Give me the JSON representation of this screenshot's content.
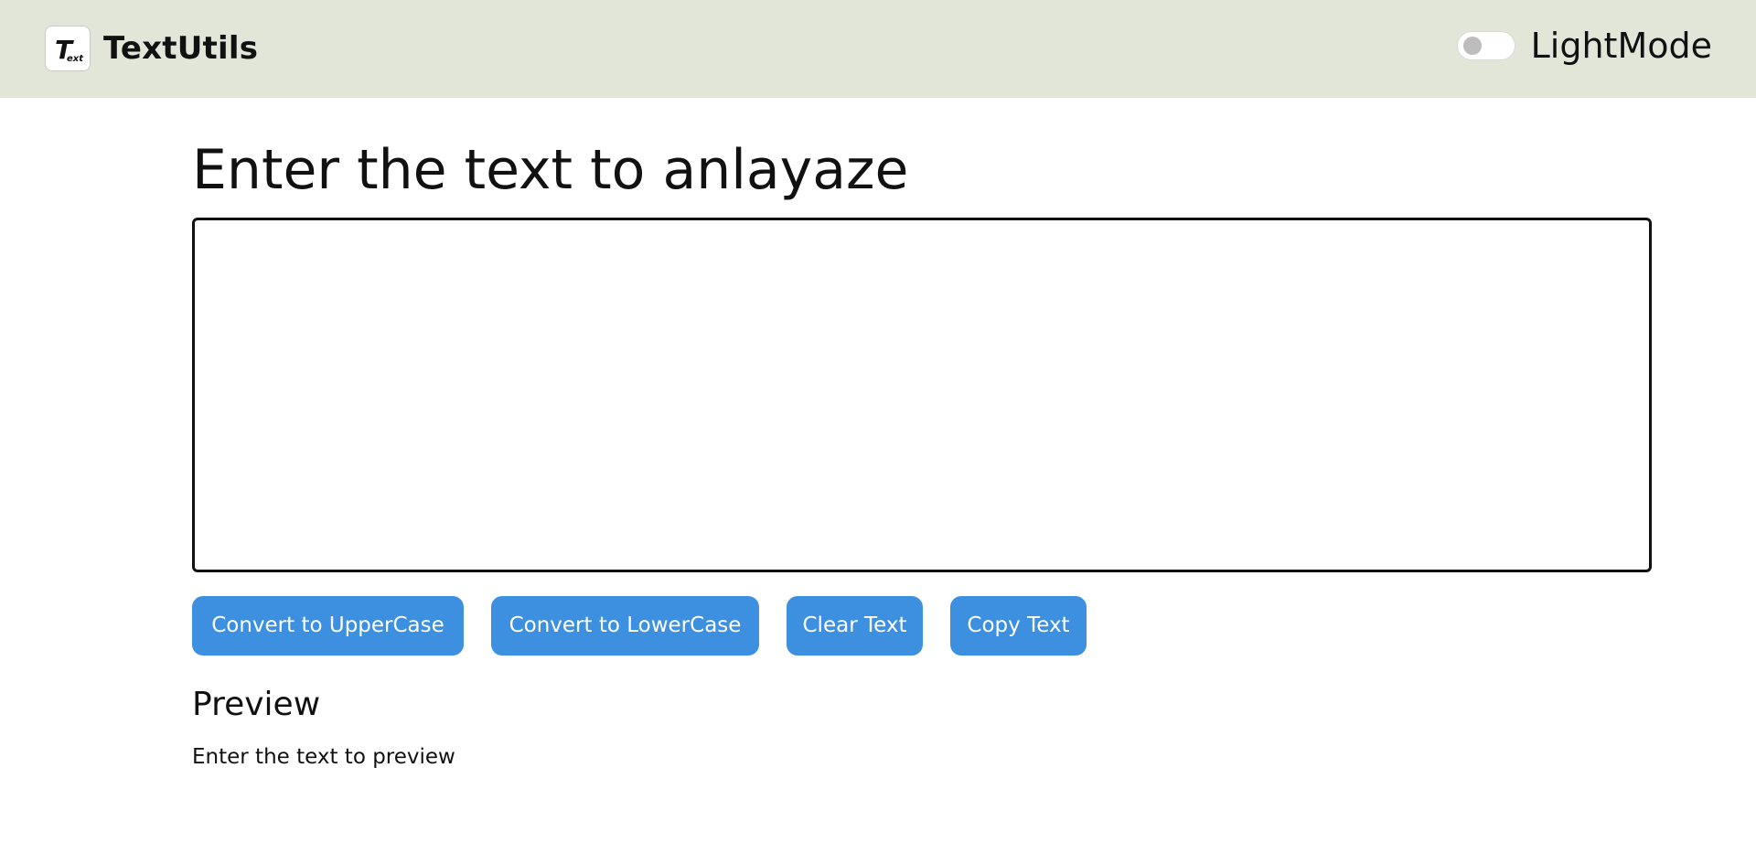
{
  "navbar": {
    "brand": "TextUtils",
    "logo_icon": "text-logo-icon",
    "mode_toggle": {
      "label": "LightMode",
      "checked": false
    }
  },
  "main": {
    "heading": "Enter the text to anlayaze",
    "textarea": {
      "value": "",
      "placeholder": ""
    },
    "buttons": [
      {
        "label": "Convert to UpperCase"
      },
      {
        "label": "Convert to LowerCase"
      },
      {
        "label": "Clear Text"
      },
      {
        "label": "Copy Text"
      }
    ],
    "preview": {
      "title": "Preview",
      "text": "Enter the text to preview"
    }
  },
  "colors": {
    "navbar_bg": "#e1e6d9",
    "button_bg": "#3d8fe0",
    "button_text": "#ffffff",
    "text": "#111111"
  }
}
